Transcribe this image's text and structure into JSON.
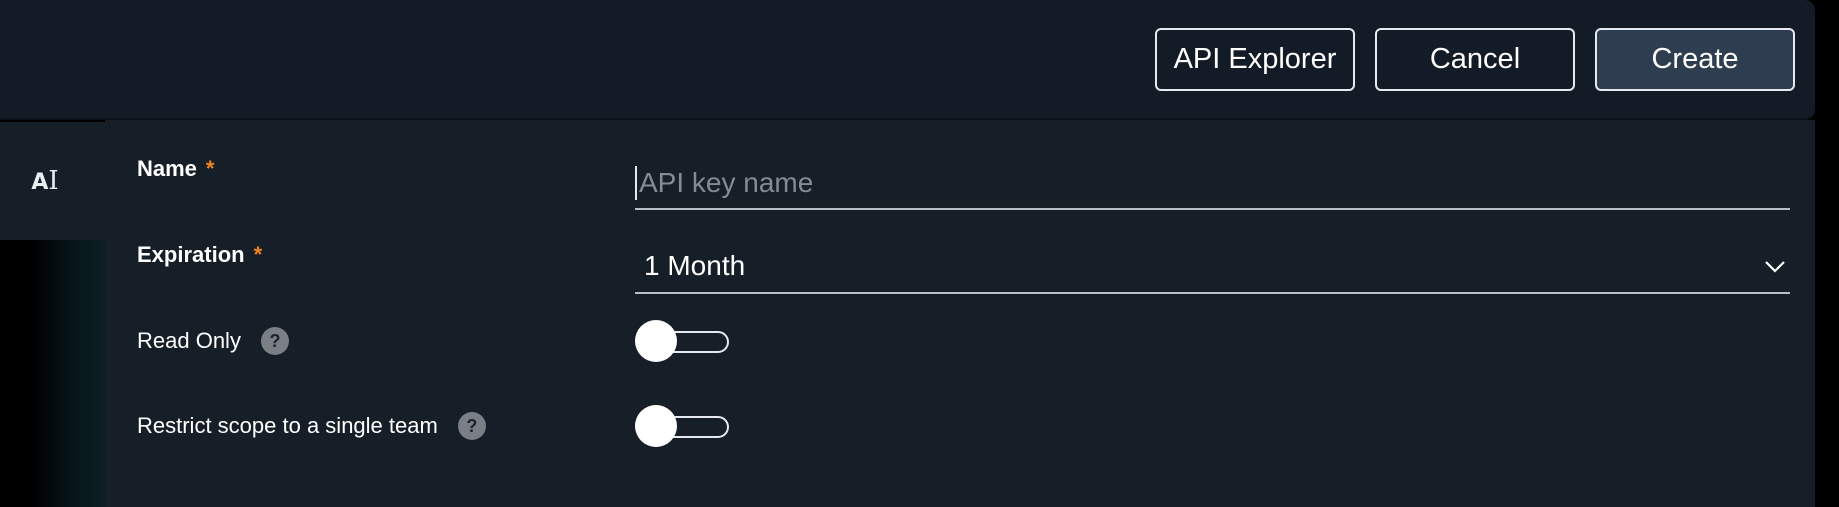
{
  "header": {
    "api_explorer_label": "API Explorer",
    "cancel_label": "Cancel",
    "create_label": "Create"
  },
  "side_tab": {
    "icon_text": "A",
    "icon_name": "ai-icon"
  },
  "form": {
    "name": {
      "label": "Name",
      "required_mark": "*",
      "value": "",
      "placeholder": "API key name"
    },
    "expiration": {
      "label": "Expiration",
      "required_mark": "*",
      "selected": "1 Month"
    },
    "read_only": {
      "label": "Read Only",
      "help_glyph": "?",
      "enabled": false
    },
    "restrict_scope": {
      "label": "Restrict scope to a single team",
      "help_glyph": "?",
      "enabled": false
    }
  },
  "colors": {
    "background": "#161e28",
    "header": "#131b26",
    "required": "#f0841c",
    "primary_button": "#2e3d50",
    "help_icon": "#7a7f86"
  }
}
